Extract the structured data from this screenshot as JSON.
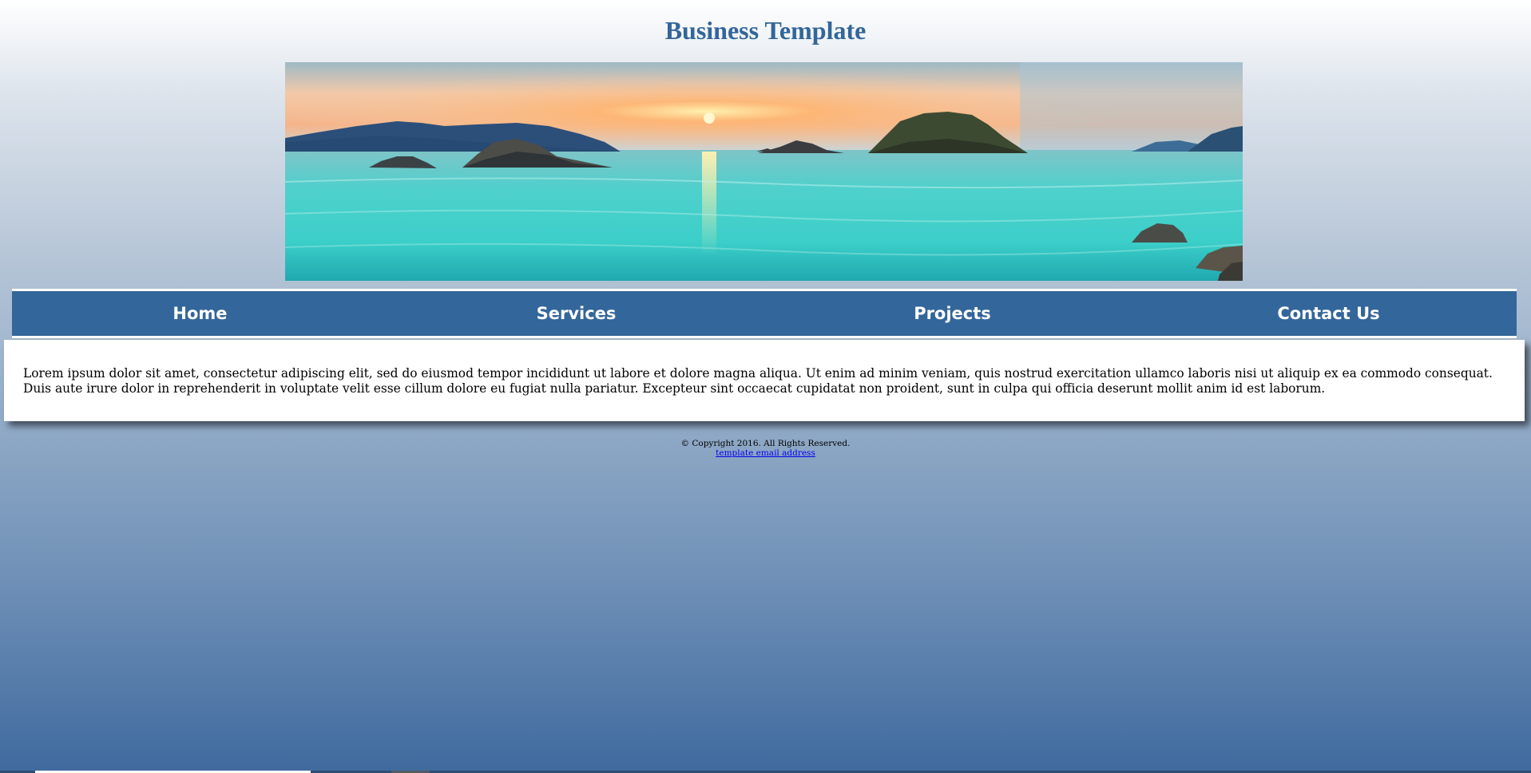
{
  "header": {
    "title": "Business Template"
  },
  "banner": {
    "image": "seascape-sunset-islands"
  },
  "nav": {
    "items": [
      {
        "label": "Home"
      },
      {
        "label": "Services"
      },
      {
        "label": "Projects"
      },
      {
        "label": "Contact Us"
      }
    ]
  },
  "content": {
    "text": "Lorem ipsum dolor sit amet, consectetur adipiscing elit, sed do eiusmod tempor incididunt ut labore et dolore magna aliqua. Ut enim ad minim veniam, quis nostrud exercitation ullamco laboris nisi ut aliquip ex ea commodo consequat. Duis aute irure dolor in reprehenderit in voluptate velit esse cillum dolore eu fugiat nulla pariatur. Excepteur sint occaecat cupidatat non proident, sunt in culpa qui officia deserunt mollit anim id est laborum."
  },
  "footer": {
    "copyright": "© Copyright 2016. All Rights Reserved.",
    "email_link": "template email address"
  },
  "colors": {
    "brand": "#33669a",
    "link": "#0000ee"
  }
}
